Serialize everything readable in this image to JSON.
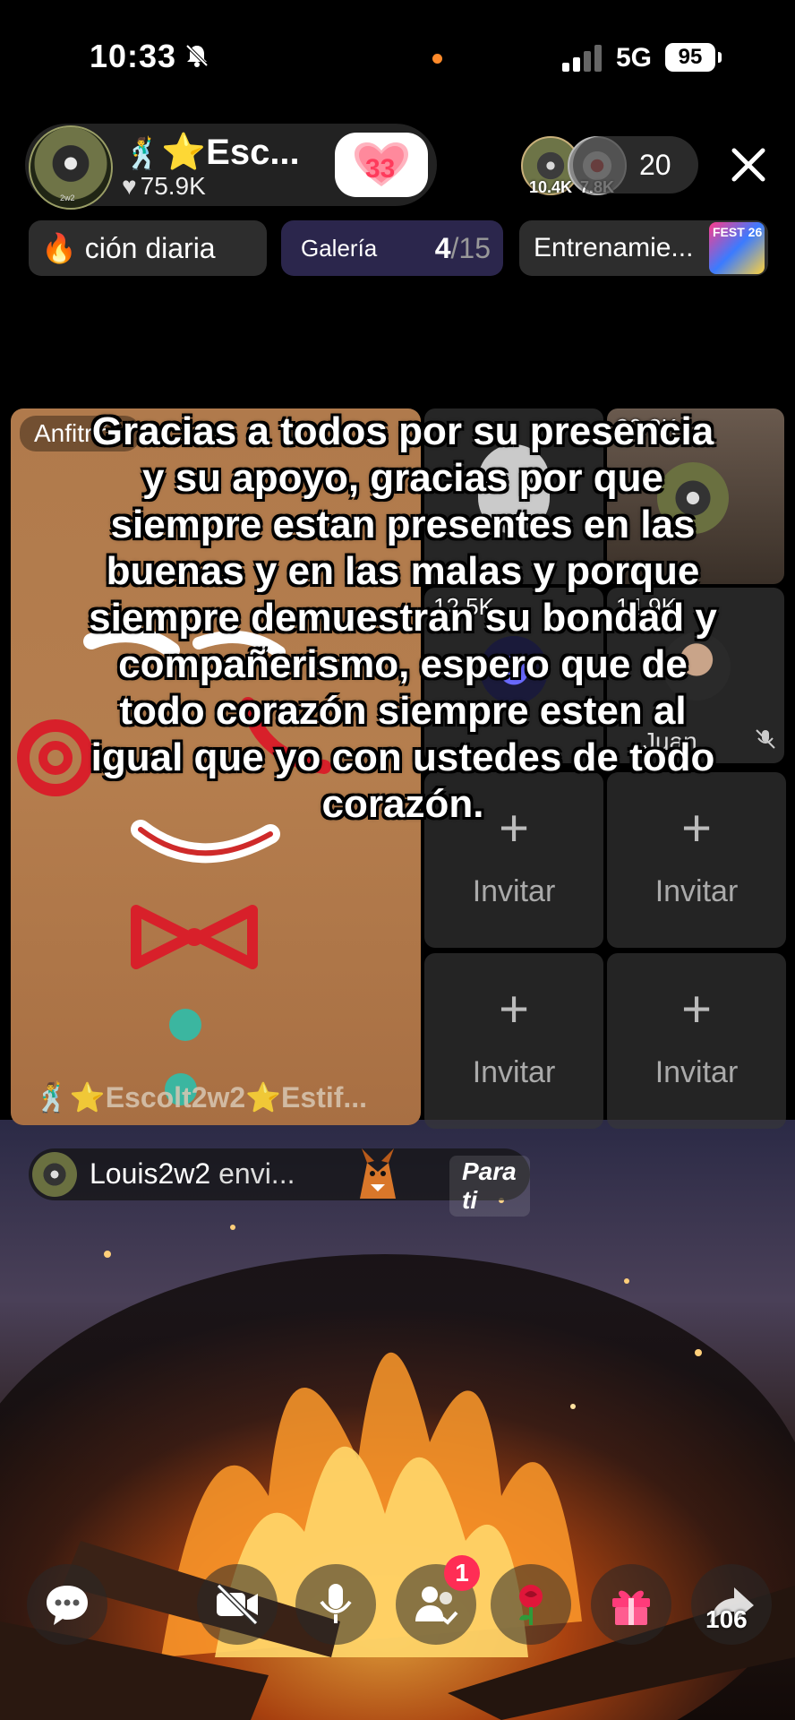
{
  "status_bar": {
    "time": "10:33",
    "network": "5G",
    "battery": "95"
  },
  "host": {
    "name": "⭐Esc...",
    "likes": "75.9K",
    "follow_count": "33"
  },
  "viewers": {
    "first_count": "10.4K",
    "second_count": "7.8K",
    "total": "20"
  },
  "chips": {
    "daily": "ción diaria",
    "gallery_label": "Galería",
    "gallery_count": "4",
    "gallery_total": "/15",
    "training": "Entrenamie...",
    "fest_badge": "FEST 26"
  },
  "host_tile": {
    "role_label": "Anfitrión",
    "footer_name": "⭐Escolt2w2⭐Estif..."
  },
  "guests": [
    {
      "count": "30.8K"
    },
    {
      "count": "12.5K"
    },
    {
      "count": "14.9K",
      "name": "Juan"
    }
  ],
  "invite_label": "Invitar",
  "caption": "Gracias a todos por su presencia y su apoyo, gracias por que siempre estan presentes en las buenas y en las malas y porque siempre demuestran su bondad y compañerismo, espero que de todo corazón siempre esten al igual que yo con ustedes de todo corazón.",
  "notification": {
    "user": "Louis2w2",
    "action": "envi...",
    "tag": "Para ti"
  },
  "toolbar": {
    "invite_badge": "1",
    "share_count": "106"
  },
  "colors": {
    "accent": "#ff2d55",
    "gallery_chip": "#2d2850",
    "status_dot": "#ff8a2a"
  }
}
